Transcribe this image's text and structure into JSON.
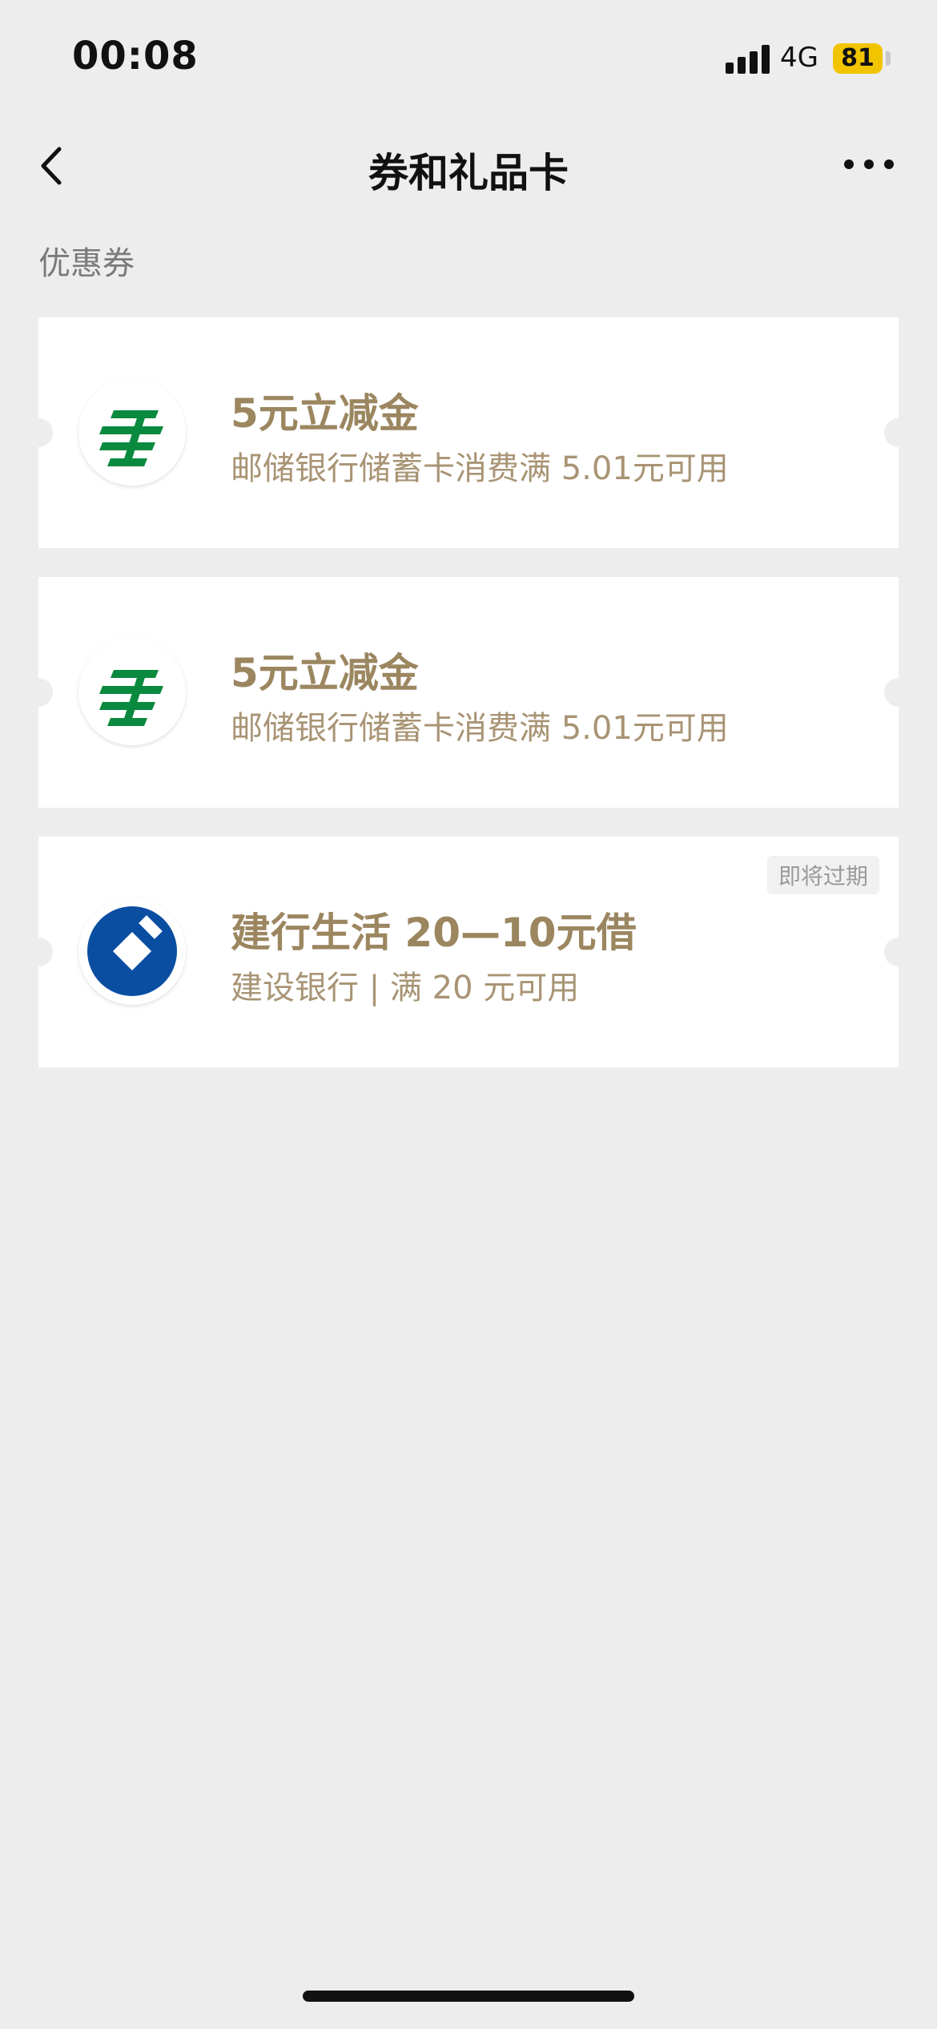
{
  "status_bar": {
    "time": "00:08",
    "network": "4G",
    "battery": "81",
    "battery_color": "#f2c400"
  },
  "nav": {
    "title": "券和礼品卡",
    "back_icon": "chevron-left-icon",
    "more_icon": "more-dots-icon"
  },
  "section": {
    "title": "优惠券"
  },
  "coupons": [
    {
      "logo": "postal-savings-bank-logo",
      "title": "5元立减金",
      "desc": "邮储银行储蓄卡消费满 5.01元可用",
      "badge": ""
    },
    {
      "logo": "postal-savings-bank-logo",
      "title": "5元立减金",
      "desc": "邮储银行储蓄卡消费满 5.01元可用",
      "badge": ""
    },
    {
      "logo": "china-construction-bank-logo",
      "title": "建行生活 20—10元借",
      "desc": "建设银行 | 满 20 元可用",
      "badge": "即将过期"
    }
  ],
  "colors": {
    "background": "#ededed",
    "coupon_title": "#9b8660",
    "coupon_desc": "#a89474",
    "postal_green": "#0a8a3e",
    "ccb_blue": "#0a4ea2"
  }
}
